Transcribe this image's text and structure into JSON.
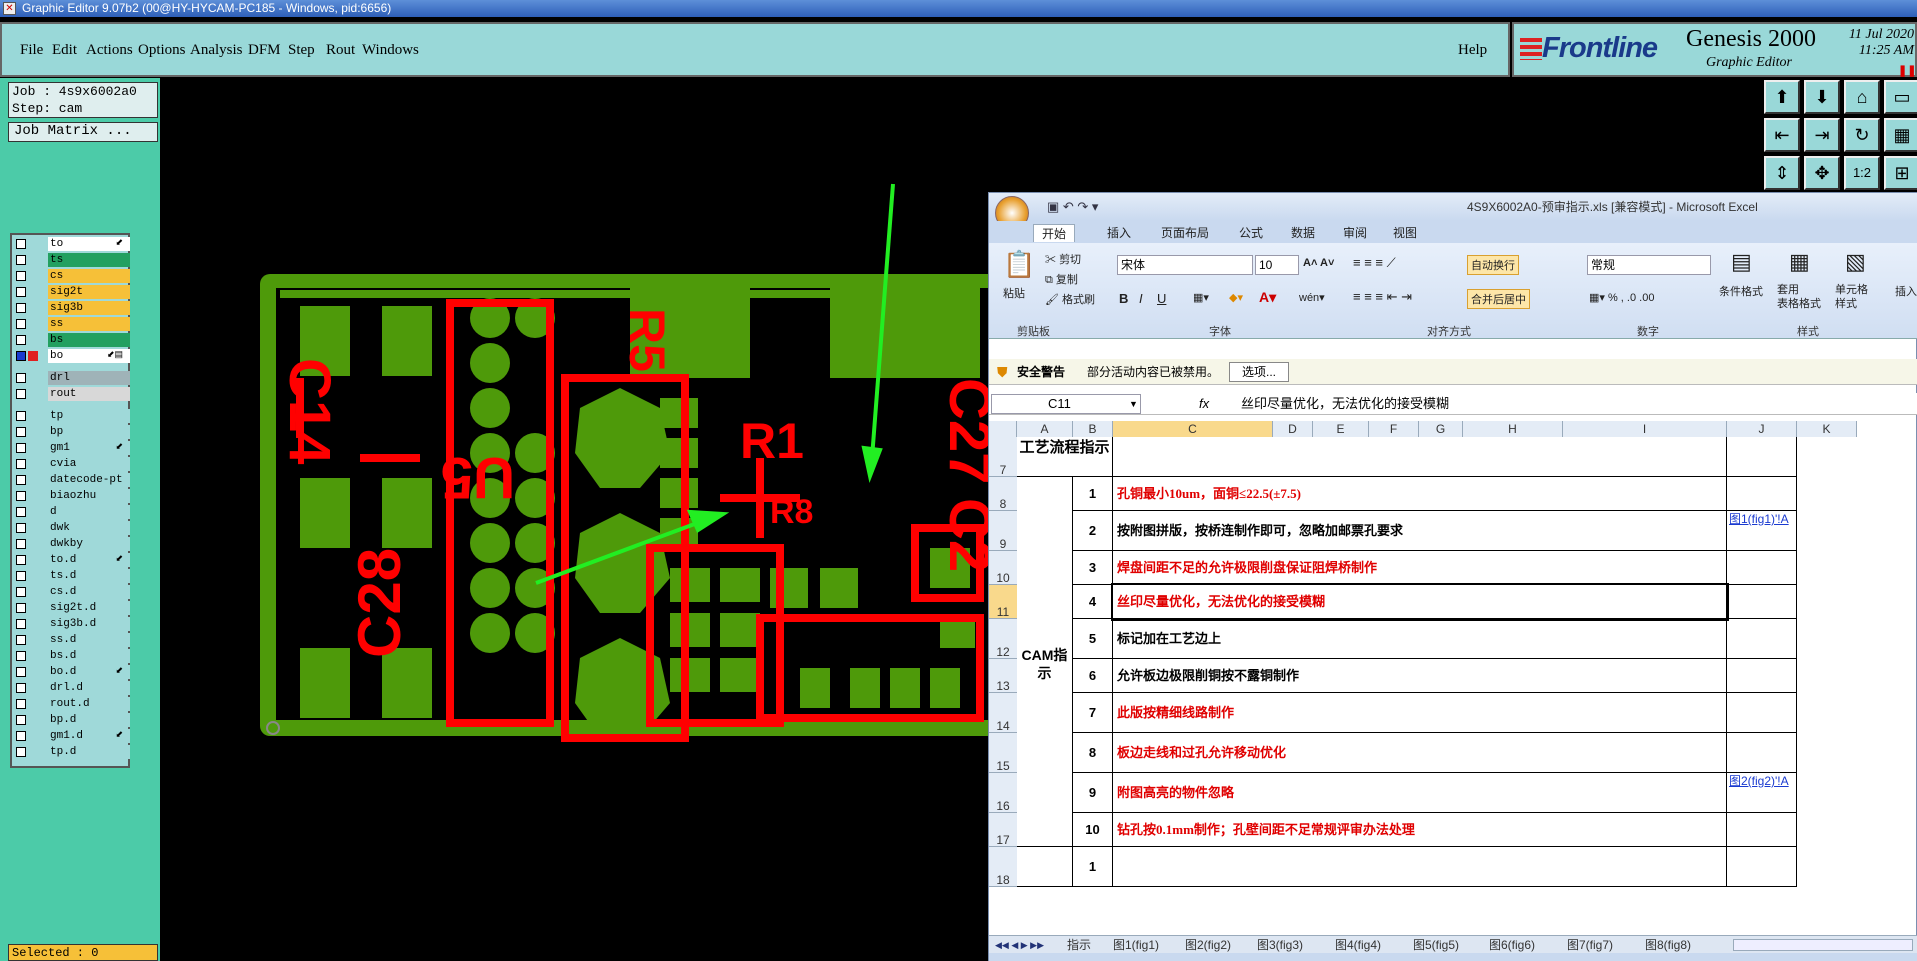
{
  "titlebar": {
    "title": "Graphic Editor 9.07b2 (00@HY-HYCAM-PC185 - Windows, pid:6656)",
    "icon": "x-icon"
  },
  "menu": {
    "file": "File",
    "edit": "Edit",
    "actions": "Actions",
    "options": "Options",
    "analysis": "Analysis",
    "dfm": "DFM",
    "step": "Step",
    "rout": "Rout",
    "windows": "Windows",
    "help": "Help"
  },
  "brand": {
    "logo": "Frontline",
    "product": "Genesis 2000",
    "subtitle": "Graphic Editor",
    "date": "11 Jul 2020",
    "time": "11:25 AM"
  },
  "job": {
    "job": "Job : 4s9x6002a0",
    "step": "Step: cam",
    "matrix": "Job Matrix ..."
  },
  "layers": [
    {
      "name": "to",
      "color": "#ffffff",
      "arrow": "⬋"
    },
    {
      "name": "ts",
      "color": "#22a060",
      "arrow": ""
    },
    {
      "name": "cs",
      "color": "#f6c038",
      "arrow": ""
    },
    {
      "name": "sig2t",
      "color": "#f6c038",
      "arrow": ""
    },
    {
      "name": "sig3b",
      "color": "#f6c038",
      "arrow": ""
    },
    {
      "name": "ss",
      "color": "#f6c038",
      "arrow": ""
    },
    {
      "name": "bs",
      "color": "#22a060",
      "arrow": ""
    },
    {
      "name": "bo",
      "color": "#ffffff",
      "arrow": "⬋▤",
      "active": true
    },
    {
      "name": "drl",
      "color": "#9fb3b8",
      "arrow": ""
    },
    {
      "name": "rout",
      "color": "#d8d8d8",
      "arrow": ""
    },
    {
      "name": "tp",
      "color": "#9fd9d9",
      "arrow": ""
    },
    {
      "name": "bp",
      "color": "#9fd9d9",
      "arrow": ""
    },
    {
      "name": "gm1",
      "color": "#9fd9d9",
      "arrow": "⬋"
    },
    {
      "name": "cvia",
      "color": "#9fd9d9",
      "arrow": ""
    },
    {
      "name": "datecode-pt",
      "color": "#9fd9d9",
      "arrow": ""
    },
    {
      "name": "biaozhu",
      "color": "#9fd9d9",
      "arrow": ""
    },
    {
      "name": "d",
      "color": "#9fd9d9",
      "arrow": ""
    },
    {
      "name": "dwk",
      "color": "#9fd9d9",
      "arrow": ""
    },
    {
      "name": "dwkby",
      "color": "#9fd9d9",
      "arrow": ""
    },
    {
      "name": "to.d",
      "color": "#9fd9d9",
      "arrow": "⬋"
    },
    {
      "name": "ts.d",
      "color": "#9fd9d9",
      "arrow": ""
    },
    {
      "name": "cs.d",
      "color": "#9fd9d9",
      "arrow": ""
    },
    {
      "name": "sig2t.d",
      "color": "#9fd9d9",
      "arrow": ""
    },
    {
      "name": "sig3b.d",
      "color": "#9fd9d9",
      "arrow": ""
    },
    {
      "name": "ss.d",
      "color": "#9fd9d9",
      "arrow": ""
    },
    {
      "name": "bs.d",
      "color": "#9fd9d9",
      "arrow": ""
    },
    {
      "name": "bo.d",
      "color": "#9fd9d9",
      "arrow": "⬋"
    },
    {
      "name": "drl.d",
      "color": "#9fd9d9",
      "arrow": ""
    },
    {
      "name": "rout.d",
      "color": "#9fd9d9",
      "arrow": ""
    },
    {
      "name": "bp.d",
      "color": "#9fd9d9",
      "arrow": ""
    },
    {
      "name": "gm1.d",
      "color": "#9fd9d9",
      "arrow": "⬋"
    },
    {
      "name": "tp.d",
      "color": "#9fd9d9",
      "arrow": ""
    }
  ],
  "selected": "Selected : 0",
  "pcb_labels": {
    "c14": "C14",
    "u5": "U5",
    "r1": "R1",
    "r8": "R8",
    "c28": "C28",
    "r5": "R5",
    "c27": "C27",
    "c2": "C2"
  },
  "colors": {
    "pcb_green": "#4e9a0a",
    "silk_red": "#ff0000",
    "arrow_green": "#22ee22",
    "panel": "#4ccba8",
    "menu": "#99d8d8"
  },
  "excel": {
    "title": "4S9X6002A0-预审指示.xls  [兼容模式]  -  Microsoft Excel",
    "tabs": [
      "开始",
      "插入",
      "页面布局",
      "公式",
      "数据",
      "审阅",
      "视图"
    ],
    "ribbon": {
      "paste": "粘贴",
      "cut": "剪切",
      "copy": "复制",
      "format_painter": "格式刷",
      "clipboard": "剪贴板",
      "font_name": "宋体",
      "font_size": "10",
      "font_group": "字体",
      "wrap": "自动换行",
      "merge": "合并后居中",
      "align_group": "对齐方式",
      "number_format": "常规",
      "number_group": "数字",
      "cond_format": "条件格式",
      "table_format": "套用\n表格格式",
      "cell_style": "单元格\n样式",
      "style_group": "样式",
      "insert": "插入"
    },
    "security": {
      "label": "安全警告",
      "message": "部分活动内容已被禁用。",
      "options": "选项..."
    },
    "namebox": "C11",
    "fx": "fx",
    "formula": "丝印尽量优化，无法优化的接受模糊",
    "columns": [
      "A",
      "B",
      "C",
      "D",
      "E",
      "F",
      "G",
      "H",
      "I",
      "J",
      "K"
    ],
    "header_cell": "工艺流程指示",
    "cam_label": "CAM指示",
    "rows": [
      {
        "row": "7",
        "no": "",
        "text": "",
        "link": ""
      },
      {
        "row": "8",
        "no": "1",
        "text": "孔铜最小10um，面铜≤22.5(±7.5)",
        "red": true,
        "link": ""
      },
      {
        "row": "9",
        "no": "2",
        "text": "按附图拼版，按桥连制作即可，忽略加邮票孔要求",
        "red": false,
        "link": "图1(fig1)'!A"
      },
      {
        "row": "10",
        "no": "3",
        "text": "焊盘间距不足的允许极限削盘保证阻焊桥制作",
        "red": true,
        "link": ""
      },
      {
        "row": "11",
        "no": "4",
        "text": "丝印尽量优化，无法优化的接受模糊",
        "red": true,
        "link": ""
      },
      {
        "row": "12",
        "no": "5",
        "text": "标记加在工艺边上",
        "red": false,
        "link": ""
      },
      {
        "row": "13",
        "no": "6",
        "text": "允许板边极限削铜按不露铜制作",
        "red": false,
        "link": ""
      },
      {
        "row": "14",
        "no": "7",
        "text": "此版按精细线路制作",
        "red": true,
        "link": ""
      },
      {
        "row": "15",
        "no": "8",
        "text": "板边走线和过孔允许移动优化",
        "red": true,
        "link": ""
      },
      {
        "row": "16",
        "no": "9",
        "text": "附图高亮的物件忽略",
        "red": true,
        "link": "图2(fig2)'!A"
      },
      {
        "row": "17",
        "no": "10",
        "text": "钻孔按0.1mm制作；孔壁间距不足常规评审办法处理",
        "red": true,
        "link": ""
      },
      {
        "row": "18",
        "no": "1",
        "text": "",
        "red": false,
        "link": ""
      }
    ],
    "sheet_tabs": [
      "指示",
      "图1(fig1)",
      "图2(fig2)",
      "图3(fig3)",
      "图4(fig4)",
      "图5(fig5)",
      "图6(fig6)",
      "图7(fig7)",
      "图8(fig8)"
    ]
  }
}
